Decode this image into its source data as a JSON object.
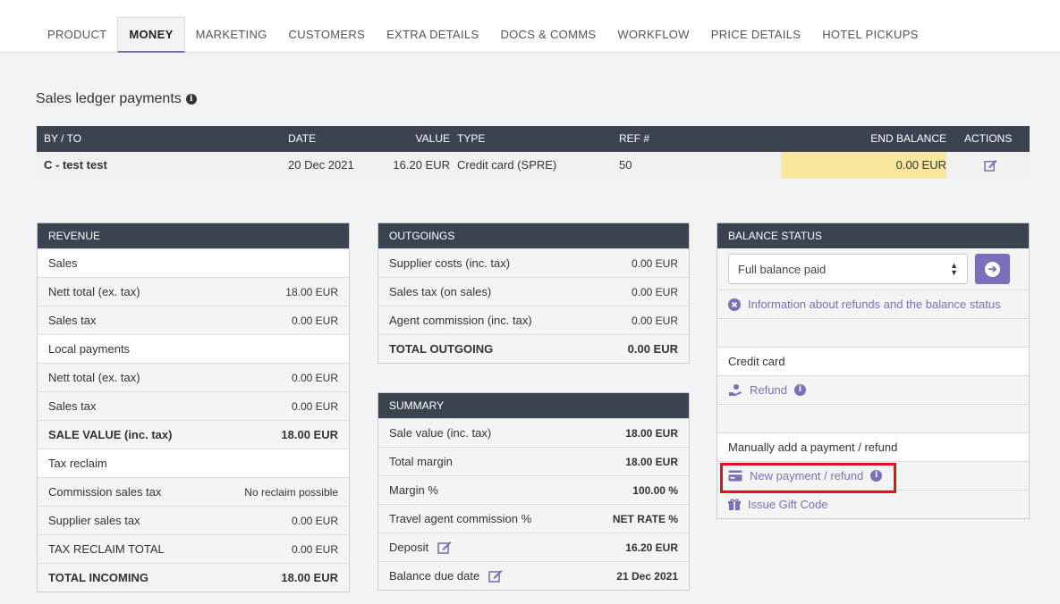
{
  "tabs": [
    "PRODUCT",
    "MONEY",
    "MARKETING",
    "CUSTOMERS",
    "EXTRA DETAILS",
    "DOCS & COMMS",
    "WORKFLOW",
    "PRICE DETAILS",
    "HOTEL PICKUPS"
  ],
  "active_tab": "MONEY",
  "ledger": {
    "title": "Sales ledger payments",
    "headers": {
      "by_to": "BY / TO",
      "date": "DATE",
      "value": "VALUE",
      "type": "TYPE",
      "ref": "REF #",
      "end_balance": "END BALANCE",
      "actions": "ACTIONS"
    },
    "row": {
      "by_to": "C - test test",
      "date": "20 Dec 2021",
      "value": "16.20 EUR",
      "type": "Credit card (SPRE)",
      "ref": "50",
      "end_balance": "0.00 EUR"
    }
  },
  "revenue": {
    "header": "REVENUE",
    "rows": [
      {
        "label": "Sales",
        "value": ""
      },
      {
        "label": "Nett total (ex. tax)",
        "value": "18.00 EUR"
      },
      {
        "label": "Sales tax",
        "value": "0.00 EUR"
      },
      {
        "label": "Local payments",
        "value": ""
      },
      {
        "label": "Nett total (ex. tax)",
        "value": "0.00 EUR"
      },
      {
        "label": "Sales tax",
        "value": "0.00 EUR"
      },
      {
        "label": "SALE VALUE (inc. tax)",
        "value": "18.00 EUR"
      },
      {
        "label": "Tax reclaim",
        "value": ""
      },
      {
        "label": "Commission sales tax",
        "value": "No reclaim possible"
      },
      {
        "label": "Supplier sales tax",
        "value": "0.00 EUR"
      },
      {
        "label": "TAX RECLAIM TOTAL",
        "value": "0.00 EUR"
      },
      {
        "label": "TOTAL INCOMING",
        "value": "18.00 EUR"
      }
    ]
  },
  "outgoings": {
    "header": "OUTGOINGS",
    "rows": [
      {
        "label": "Supplier costs (inc. tax)",
        "value": "0.00 EUR"
      },
      {
        "label": "Sales tax (on sales)",
        "value": "0.00 EUR"
      },
      {
        "label": "Agent commission (inc. tax)",
        "value": "0.00 EUR"
      },
      {
        "label": "TOTAL OUTGOING",
        "value": "0.00 EUR"
      }
    ]
  },
  "summary": {
    "header": "SUMMARY",
    "rows": [
      {
        "label": "Sale value (inc. tax)",
        "value": "18.00 EUR"
      },
      {
        "label": "Total margin",
        "value": "18.00 EUR"
      },
      {
        "label": "Margin %",
        "value": "100.00 %"
      },
      {
        "label": "Travel agent commission %",
        "value": "NET RATE %"
      },
      {
        "label": "Deposit",
        "value": "16.20 EUR"
      },
      {
        "label": "Balance due date",
        "value": "21 Dec 2021"
      }
    ]
  },
  "balance_status": {
    "header": "BALANCE STATUS",
    "select_value": "Full balance paid",
    "info_link": "Information about refunds and the balance status",
    "credit_card_label": "Credit card",
    "refund_link": "Refund",
    "manual_label": "Manually add a payment / refund",
    "new_payment_link": "New payment / refund",
    "gift_code_link": "Issue Gift Code"
  },
  "colors": {
    "accent": "#7a6fb8",
    "header_bg": "#3c4350",
    "highlight": "#f7e69b",
    "annotation": "#e0141e"
  }
}
